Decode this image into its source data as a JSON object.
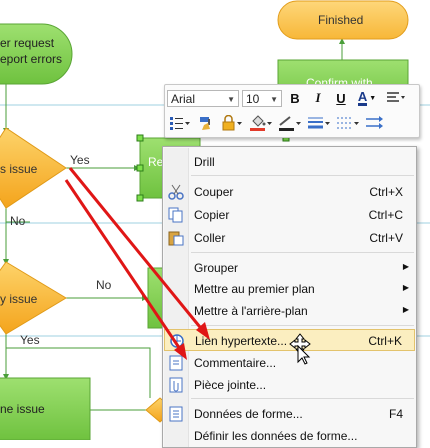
{
  "diagram": {
    "start_terminal": {
      "line1": "er request",
      "line2": "eport errors"
    },
    "finished_terminal": "Finished",
    "confirm_box": "Confirm with",
    "decision1": "s issue",
    "decision2": "y issue",
    "process_partial": "Re",
    "bottom_box": "ne issue",
    "yes1": "Yes",
    "no1": "No",
    "no2": "No",
    "yes2": "Yes"
  },
  "toolbar": {
    "font_family": "Arial",
    "font_size": "10",
    "bold": "B",
    "italic": "I",
    "underline": "U",
    "font_color_letter": "A",
    "icons": [
      "align-icon",
      "bullets-icon",
      "format-painter-icon",
      "lock-icon",
      "fill-icon",
      "line-color-icon",
      "line-weight-icon",
      "dash-icon",
      "arrows-icon"
    ]
  },
  "menu": {
    "drill": "Drill",
    "cut": "Couper",
    "cut_sc": "Ctrl+X",
    "copy": "Copier",
    "copy_sc": "Ctrl+C",
    "paste": "Coller",
    "paste_sc": "Ctrl+V",
    "group": "Grouper",
    "front": "Mettre au premier plan",
    "back": "Mettre à l'arrière-plan",
    "hyperlink": "Lien hypertexte...",
    "hyperlink_sc": "Ctrl+K",
    "comment": "Commentaire...",
    "attachment": "Pièce jointe...",
    "shape_data": "Données de forme...",
    "shape_data_sc": "F4",
    "define_shape_data": "Définir les données de forme..."
  },
  "colors": {
    "orange_fill": "#f8b42c",
    "green_fill": "#7ccf4e",
    "highlight": "#fbeec0",
    "annotation_red": "#e01616"
  }
}
